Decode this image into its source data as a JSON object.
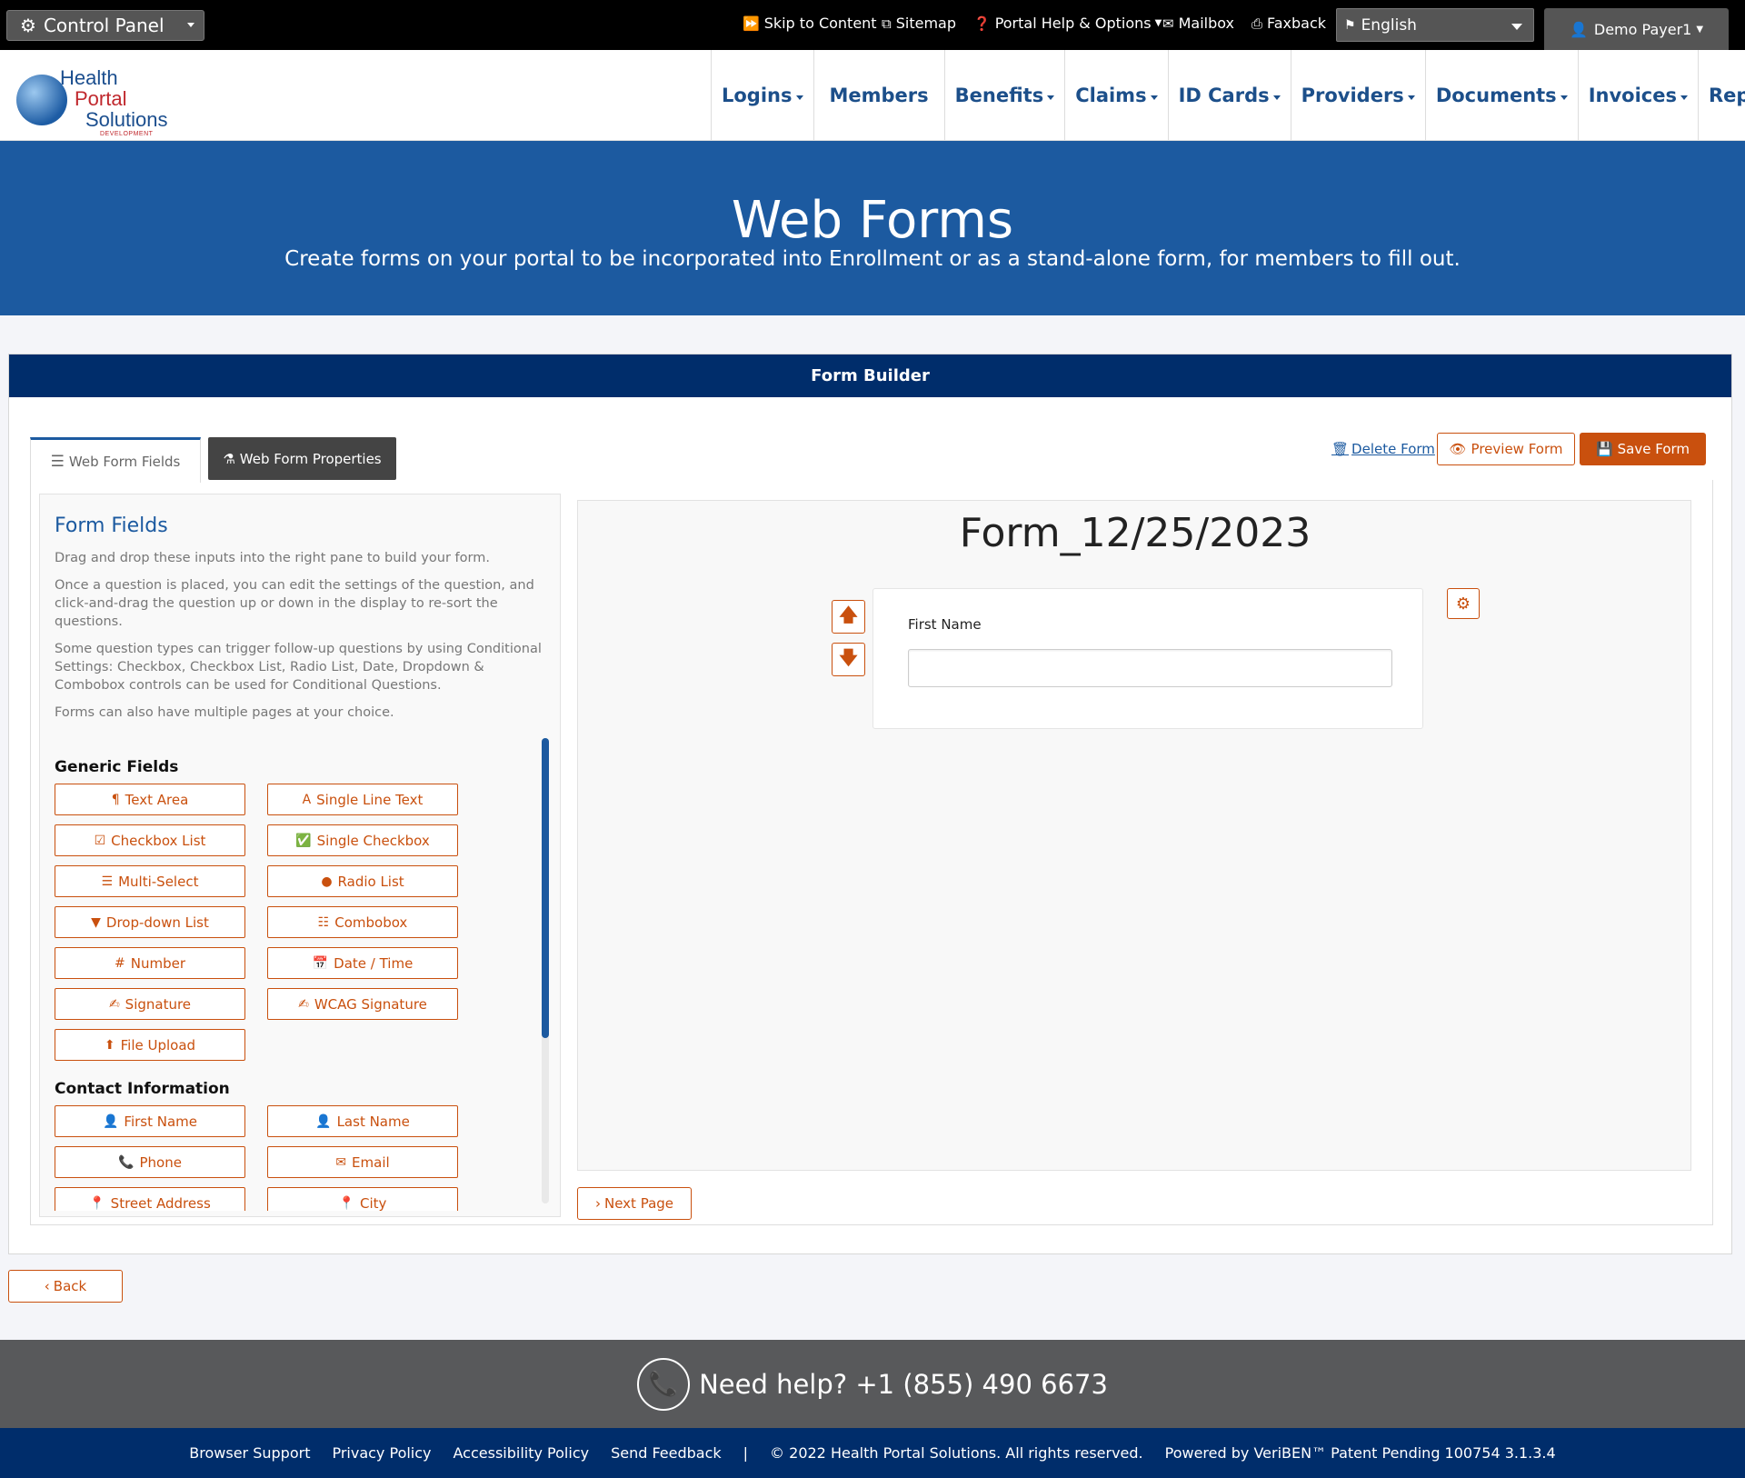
{
  "topbar": {
    "control_panel": "Control Panel",
    "skip": "Skip to Content",
    "sitemap": "Sitemap",
    "help": "Portal Help & Options",
    "mailbox": "Mailbox",
    "faxback": "Faxback",
    "language": "English",
    "user": "Demo Payer1"
  },
  "logo": {
    "line1": "Health",
    "line2": "Portal",
    "line3": "Solutions",
    "line4": "DEVELOPMENT"
  },
  "nav": [
    "Logins",
    "Members",
    "Benefits",
    "Claims",
    "ID Cards",
    "Providers",
    "Documents",
    "Invoices",
    "Reports"
  ],
  "hero": {
    "title": "Web Forms",
    "subtitle": "Create forms on your portal to be incorporated into Enrollment or as a stand-alone form, for members to fill out."
  },
  "builder": {
    "header": "Form Builder",
    "tab_fields": "Web Form Fields",
    "tab_properties": "Web Form Properties",
    "delete": "Delete Form",
    "preview": "Preview Form",
    "save": "Save Form",
    "next_page": "Next Page",
    "back": "Back"
  },
  "fields_panel": {
    "title": "Form Fields",
    "p1": "Drag and drop these inputs into the right pane to build your form.",
    "p2": "Once a question is placed, you can edit the settings of the question, and click-and-drag the question up or down in the display to re-sort the questions.",
    "p3": "Some question types can trigger follow-up questions by using Conditional Settings: Checkbox, Checkbox List, Radio List, Date, Dropdown & Combobox controls can be used for Conditional Questions.",
    "p4": "Forms can also have multiple pages at your choice.",
    "generic_title": "Generic Fields",
    "generic": [
      "Text Area",
      "Single Line Text",
      "Checkbox List",
      "Single Checkbox",
      "Multi-Select",
      "Radio List",
      "Drop-down List",
      "Combobox",
      "Number",
      "Date / Time",
      "Signature",
      "WCAG Signature",
      "File Upload"
    ],
    "contact_title": "Contact Information",
    "contact": [
      "First Name",
      "Last Name",
      "Phone",
      "Email",
      "Street Address",
      "City"
    ]
  },
  "form": {
    "title": "Form_12/25/2023",
    "question_label": "First Name"
  },
  "footer": {
    "help": "Need help? +1 (855) 490 6673",
    "links": [
      "Browser Support",
      "Privacy Policy",
      "Accessibility Policy",
      "Send Feedback"
    ],
    "separator": "|",
    "copyright": "© 2022 Health Portal Solutions. All rights reserved.",
    "powered": "Powered by VeriBEN™ Patent Pending 100754 3.1.3.4"
  }
}
